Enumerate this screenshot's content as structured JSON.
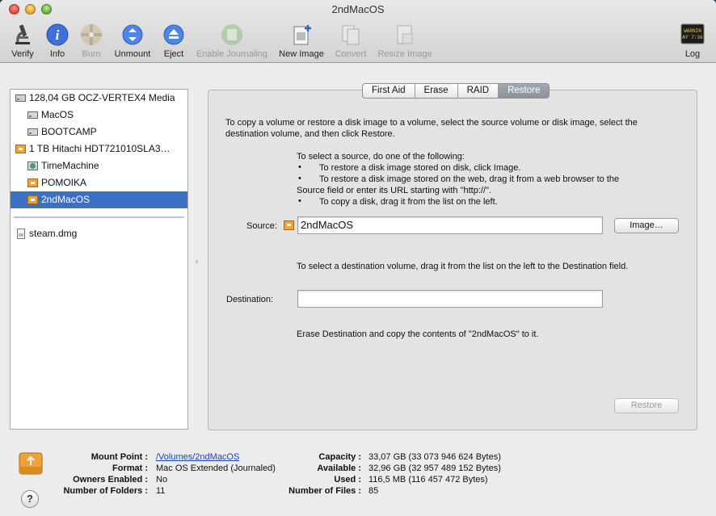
{
  "window": {
    "title": "2ndMacOS"
  },
  "toolbar": {
    "items": [
      {
        "label": "Verify",
        "icon": "microscope-icon",
        "enabled": true
      },
      {
        "label": "Info",
        "icon": "info-icon",
        "enabled": true
      },
      {
        "label": "Burn",
        "icon": "burn-disc-icon",
        "enabled": false
      },
      {
        "label": "Unmount",
        "icon": "unmount-icon",
        "enabled": true
      },
      {
        "label": "Eject",
        "icon": "eject-icon",
        "enabled": true
      },
      {
        "label": "Enable Journaling",
        "icon": "journaling-icon",
        "enabled": false
      },
      {
        "label": "New Image",
        "icon": "new-image-icon",
        "enabled": true
      },
      {
        "label": "Convert",
        "icon": "convert-icon",
        "enabled": false
      },
      {
        "label": "Resize Image",
        "icon": "resize-image-icon",
        "enabled": false
      }
    ],
    "log": {
      "label": "Log",
      "icon_text": "WARNIN AY 7:36"
    }
  },
  "sidebar": {
    "items": [
      {
        "label": "128,04 GB OCZ-VERTEX4 Media",
        "kind": "disk"
      },
      {
        "label": "MacOS",
        "kind": "volume"
      },
      {
        "label": "BOOTCAMP",
        "kind": "volume"
      },
      {
        "label": "1 TB Hitachi HDT721010SLA3…",
        "kind": "external-disk"
      },
      {
        "label": "TimeMachine",
        "kind": "timemachine-volume"
      },
      {
        "label": "POMOIKA",
        "kind": "external-volume"
      },
      {
        "label": "2ndMacOS",
        "kind": "external-volume",
        "selected": true
      },
      {
        "label": "steam.dmg",
        "kind": "image"
      }
    ]
  },
  "tabs": [
    {
      "label": "First Aid"
    },
    {
      "label": "Erase"
    },
    {
      "label": "RAID"
    },
    {
      "label": "Restore",
      "active": true
    }
  ],
  "restore": {
    "intro_1": "To copy a volume or restore a disk image to a volume, select the source volume or disk image, select the",
    "intro_2": "destination volume, and then click Restore.",
    "select_source": "To select a source, do one of the following:",
    "bullet": "•",
    "bullets": [
      "To restore a disk image stored on disk, click Image.",
      "To restore a disk image stored on the web, drag it from a web browser to the",
      "Source field or enter its URL starting with \"http://\".",
      "To copy a disk, drag it from the list on the left."
    ],
    "source_label": "Source:",
    "source_value": "2ndMacOS",
    "image_button": "Image…",
    "dest_hint": "To select a destination volume, drag it from the list on the left to the Destination field.",
    "destination_label": "Destination:",
    "destination_value": "",
    "erase_note": "Erase Destination and copy the contents of \"2ndMacOS\" to it.",
    "restore_button": "Restore"
  },
  "info": {
    "left": [
      {
        "label": "Mount Point :",
        "value": "/Volumes/2ndMacOS",
        "link": true
      },
      {
        "label": "Format :",
        "value": "Mac OS Extended (Journaled)"
      },
      {
        "label": "Owners Enabled :",
        "value": "No"
      },
      {
        "label": "Number of Folders :",
        "value": "11"
      }
    ],
    "right": [
      {
        "label": "Capacity :",
        "value": "33,07 GB (33 073 946 624 Bytes)"
      },
      {
        "label": "Available :",
        "value": "32,96 GB (32 957 489 152 Bytes)"
      },
      {
        "label": "Used :",
        "value": "116,5 MB (116 457 472 Bytes)"
      },
      {
        "label": "Number of Files :",
        "value": "85"
      }
    ]
  },
  "help": {
    "label": "?"
  },
  "colors": {
    "selection": "#3d6fc7",
    "link": "#1f3fb5",
    "external_drive": "#f0a23a"
  }
}
